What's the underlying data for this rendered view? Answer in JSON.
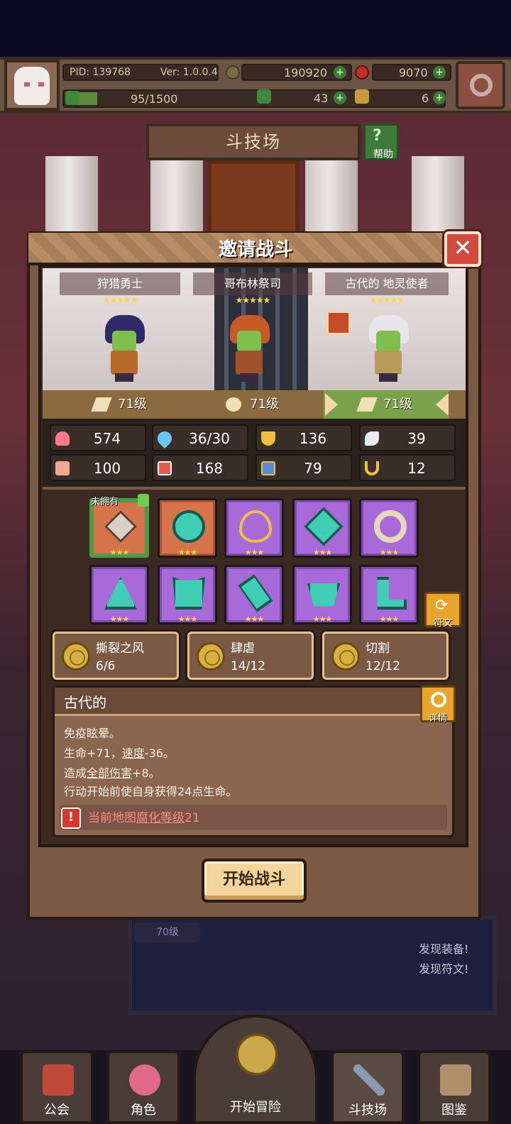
{
  "header": {
    "pid": "PID: 139768",
    "version": "Ver: 1.0.0.4",
    "gold": "190920",
    "gems": "9070",
    "exp": "95/1500",
    "exp_progress": 0.0633,
    "clover": "43",
    "keys": "6"
  },
  "arena": {
    "title": "斗技场",
    "help_label": "帮助",
    "help_symbol": "?"
  },
  "dialog": {
    "title": "邀请战斗",
    "close_symbol": "✕",
    "heroes": [
      {
        "name": "狩猎勇士",
        "stars": "★★★★★",
        "level": "71级"
      },
      {
        "name": "哥布林祭司",
        "stars": "★★★★★",
        "level": "71级"
      },
      {
        "name": "古代的 地灵使者",
        "stars": "★★★★★",
        "level": "71级"
      }
    ],
    "selected_hero": 2,
    "stats": [
      {
        "icon": "heart-icon",
        "value": "574",
        "color": "#ff7a8a"
      },
      {
        "icon": "water-drop-icon",
        "value": "36/30",
        "color": "#6ac8f0"
      },
      {
        "icon": "shield-icon",
        "value": "136",
        "color": "#f0c040"
      },
      {
        "icon": "wing-icon",
        "value": "39",
        "color": "#e8ecf0"
      },
      {
        "icon": "fist-icon",
        "value": "100",
        "color": "#f0a890"
      },
      {
        "icon": "book-icon",
        "value": "168",
        "color": "#e85a4a"
      },
      {
        "icon": "magic-shield-icon",
        "value": "79",
        "color": "#5a8ad8"
      },
      {
        "icon": "horseshoe-icon",
        "value": "12",
        "color": "#f0c040"
      }
    ],
    "equipment_stars": "★★★",
    "not_owned_label": "未拥有",
    "rune_label": "符文",
    "rune_symbol": "⟳",
    "skills": [
      {
        "name": "撕裂之风",
        "count": "6/6"
      },
      {
        "name": "肆虐",
        "count": "14/12"
      },
      {
        "name": "切割",
        "count": "12/12"
      }
    ],
    "description": {
      "title": "古代的",
      "detail_label": "详情",
      "line1": "免疫眩晕。",
      "line2_a": "生命+71，",
      "line2_b": "速度",
      "line2_c": "-36。",
      "line3_a": "造成",
      "line3_b": "全部伤害",
      "line3_c": "+8。",
      "line4": "行动开始前使自身获得24点生命。",
      "warning_a": "当前地图",
      "warning_b": "腐化等级",
      "warning_c": "21",
      "warning_symbol": "!"
    },
    "start_button": "开始战斗"
  },
  "background": {
    "level_tag": "70级",
    "find_equipment": "发现装备!",
    "find_rune": "发现符文!"
  },
  "nav": {
    "guild": "公会",
    "character": "角色",
    "adventure": "开始冒险",
    "arena": "斗技场",
    "codex": "图鉴"
  }
}
